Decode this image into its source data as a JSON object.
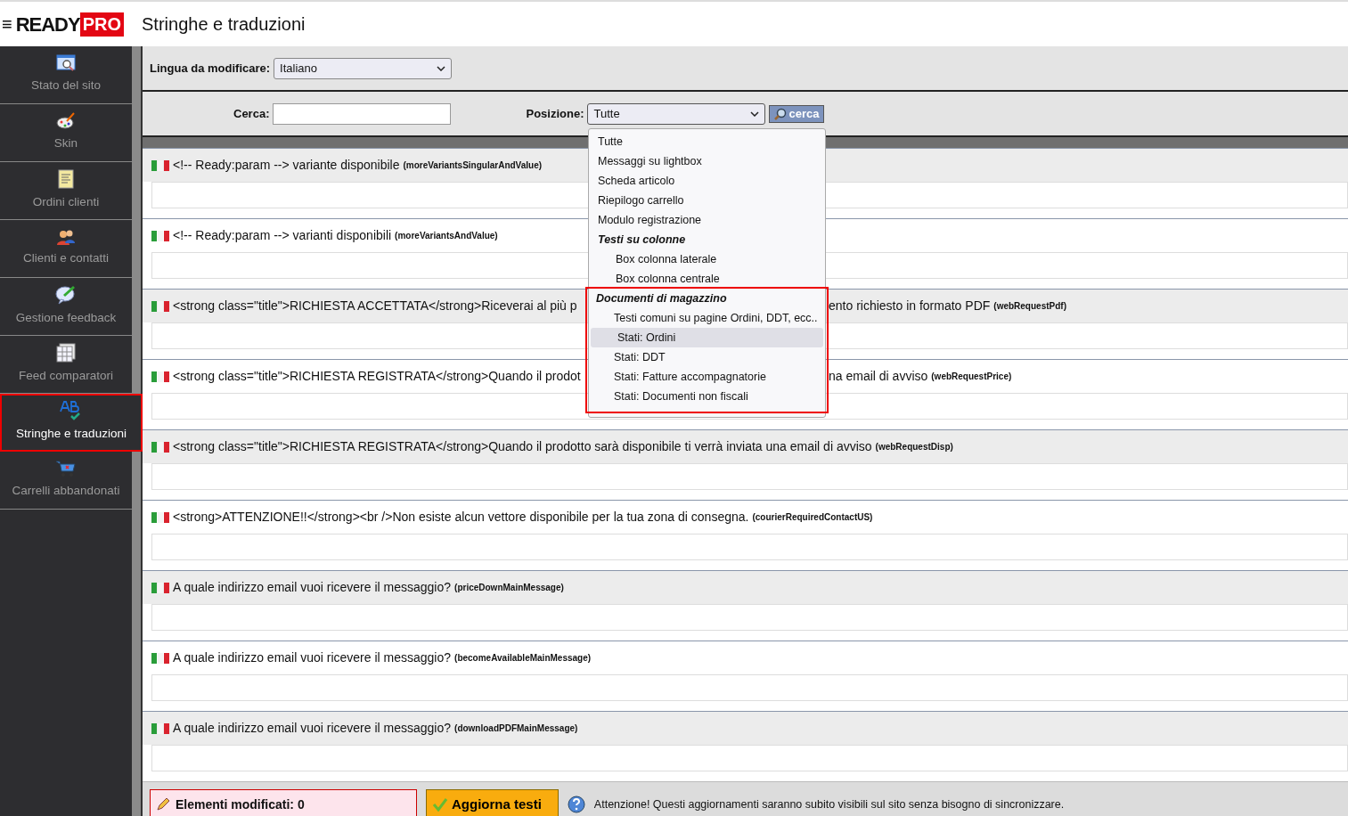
{
  "header": {
    "menu_glyph": "≡",
    "logo": {
      "text": "READY",
      "badge": "PRO"
    },
    "title": "Stringhe e traduzioni"
  },
  "sidebar": {
    "items": [
      {
        "label": "Stato del sito",
        "selected": false
      },
      {
        "label": "Skin",
        "selected": false
      },
      {
        "label": "Ordini clienti",
        "selected": false
      },
      {
        "label": "Clienti e contatti",
        "selected": false
      },
      {
        "label": "Gestione feedback",
        "selected": false
      },
      {
        "label": "Feed comparatori",
        "selected": false
      },
      {
        "label": "Stringhe e traduzioni",
        "selected": true
      },
      {
        "label": "Carrelli abbandonati",
        "selected": false
      }
    ]
  },
  "filters": {
    "language": {
      "label": "Lingua da modificare:",
      "value": "Italiano"
    },
    "search": {
      "label": "Cerca:"
    },
    "position": {
      "label": "Posizione:",
      "value": "Tutte",
      "expanded": true
    },
    "search_button": "cerca"
  },
  "position_menu": [
    {
      "kind": "option",
      "label": "Tutte",
      "hovered": false
    },
    {
      "kind": "option",
      "label": "Messaggi su lightbox",
      "hovered": false
    },
    {
      "kind": "option",
      "label": "Scheda articolo",
      "hovered": false
    },
    {
      "kind": "option",
      "label": "Riepilogo carrello",
      "hovered": false
    },
    {
      "kind": "option",
      "label": "Modulo registrazione",
      "hovered": false
    },
    {
      "kind": "group",
      "label": "Testi su colonne",
      "marked": false,
      "children": [
        {
          "label": "Box colonna laterale",
          "hovered": false
        },
        {
          "label": "Box colonna centrale",
          "hovered": false
        }
      ]
    },
    {
      "kind": "group",
      "label": "Documenti di magazzino",
      "marked": true,
      "children": [
        {
          "label": "Testi comuni su pagine Ordini, DDT, ecc..",
          "hovered": false
        },
        {
          "label": "Stati: Ordini",
          "hovered": true
        },
        {
          "label": "Stati: DDT",
          "hovered": false
        },
        {
          "label": "Stati: Fatture accompagnatorie",
          "hovered": false
        },
        {
          "label": "Stati: Documenti non fiscali",
          "hovered": false
        }
      ]
    }
  ],
  "strings": [
    {
      "text": "<!-- Ready:param --> variante disponibile",
      "key": "(moreVariantsSingularAndValue)"
    },
    {
      "text": "<!-- Ready:param --> varianti disponibili",
      "key": "(moreVariantsAndValue)"
    },
    {
      "text": "<strong class=\"title\">RICHIESTA ACCETTATA</strong>Riceverai al più p",
      "text_after": "ento richiesto in formato PDF",
      "key": "(webRequestPdf)"
    },
    {
      "text": "<strong class=\"title\">RICHIESTA REGISTRATA</strong>Quando il prodot",
      "text_after": "na email di avviso",
      "key": "(webRequestPrice)"
    },
    {
      "text": "<strong class=\"title\">RICHIESTA REGISTRATA</strong>Quando il prodotto sarà disponibile ti verrà inviata una email di avviso",
      "key": "(webRequestDisp)"
    },
    {
      "text": "<strong>ATTENZIONE!!</strong><br />Non esiste alcun vettore disponibile per la tua zona di consegna.",
      "key": "(courierRequiredContactUS)"
    },
    {
      "text": "A quale indirizzo email vuoi ricevere il messaggio?",
      "key": "(priceDownMainMessage)"
    },
    {
      "text": "A quale indirizzo email vuoi ricevere il messaggio?",
      "key": "(becomeAvailableMainMessage)"
    },
    {
      "text": "A quale indirizzo email vuoi ricevere il messaggio?",
      "key": "(downloadPDFMainMessage)"
    }
  ],
  "footer": {
    "modified": "Elementi modificati: 0",
    "update_button": "Aggiorna testi",
    "notice": "Attenzione! Questi aggiornamenti saranno subito visibili sul sito senza bisogno di sincronizzare."
  }
}
